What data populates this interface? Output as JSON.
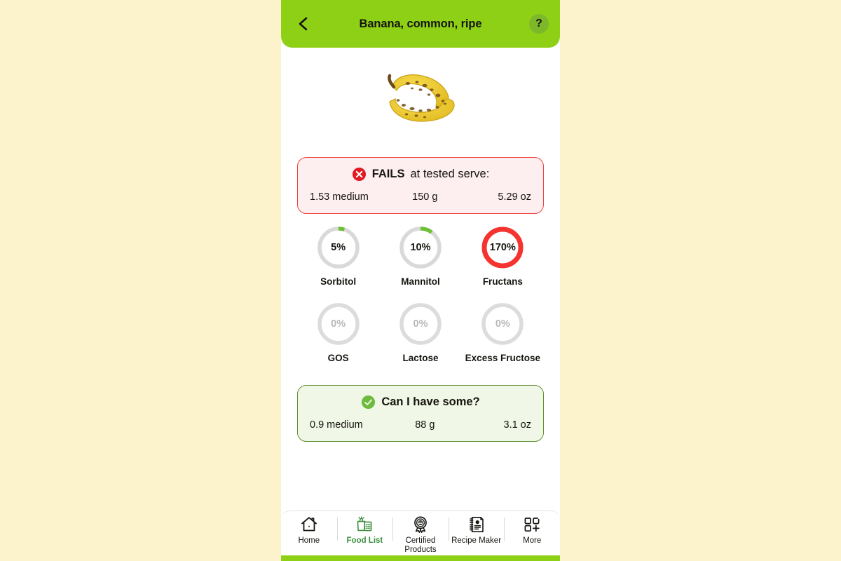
{
  "colors": {
    "page_background": "#fcf2cc",
    "brand_green": "#8ed016",
    "help_green": "#7cb82a",
    "fail_red": "#ef4444",
    "fail_bg": "#fdeef0",
    "pass_green_border": "#5f9134",
    "pass_bg": "#f1f7e6",
    "gauge_track": "#d9d9d9",
    "gauge_green": "#6cc033",
    "gauge_over": "#f5332f",
    "active_tab": "#3f8f3f"
  },
  "header": {
    "back_icon": "chevron-left-icon",
    "title": "Banana, common, ripe",
    "help_label": "?"
  },
  "hero": {
    "image_name": "ripe-banana-image",
    "alt": "Two ripe spotted bananas"
  },
  "fail_banner": {
    "icon": "x-circle-icon",
    "title_strong": "FAILS",
    "title_rest": "at tested serve:",
    "serving_household": "1.53 medium",
    "serving_grams": "150 g",
    "serving_ounces": "5.29 oz"
  },
  "gauges": [
    {
      "label": "Sorbitol",
      "value": "5%",
      "percent": 5,
      "state": "ok"
    },
    {
      "label": "Mannitol",
      "value": "10%",
      "percent": 10,
      "state": "ok"
    },
    {
      "label": "Fructans",
      "value": "170%",
      "percent": 170,
      "state": "over"
    },
    {
      "label": "GOS",
      "value": "0%",
      "percent": 0,
      "state": "zero"
    },
    {
      "label": "Lactose",
      "value": "0%",
      "percent": 0,
      "state": "zero"
    },
    {
      "label": "Excess Fructose",
      "value": "0%",
      "percent": 0,
      "state": "zero"
    }
  ],
  "pass_banner": {
    "icon": "check-circle-icon",
    "title_strong": "Can I have some?",
    "serving_household": "0.9 medium",
    "serving_grams": "88 g",
    "serving_ounces": "3.1 oz"
  },
  "bottom_nav": {
    "items": [
      {
        "label": "Home",
        "icon": "home-icon",
        "active": false
      },
      {
        "label": "Food List",
        "icon": "grocery-bag-checklist-icon",
        "active": true
      },
      {
        "label": "Certified Products",
        "icon": "award-rosette-icon",
        "active": false
      },
      {
        "label": "Recipe Maker",
        "icon": "recipe-notebook-icon",
        "active": false
      },
      {
        "label": "More",
        "icon": "grid-plus-icon",
        "active": false
      }
    ]
  }
}
